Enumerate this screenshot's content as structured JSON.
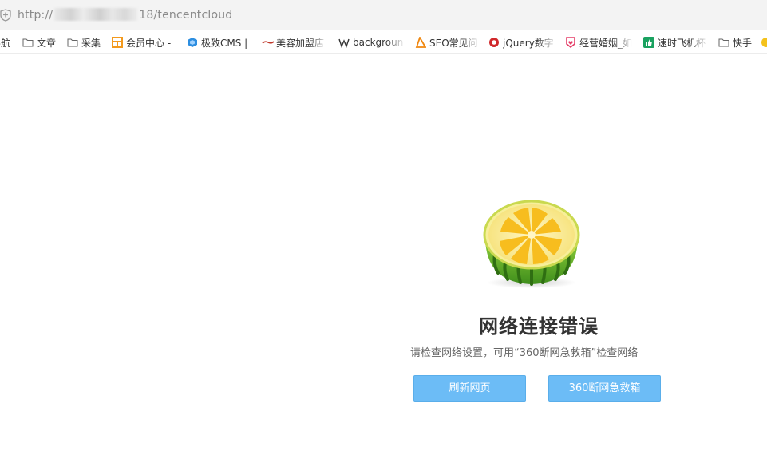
{
  "address_bar": {
    "url_prefix": "http://",
    "url_suffix": "18/tencentcloud",
    "icon": "shield-icon"
  },
  "bookmarks": [
    {
      "label": "导航",
      "icon": "partial-icon"
    },
    {
      "label": "文章",
      "icon": "folder-icon"
    },
    {
      "label": "采集",
      "icon": "folder-icon"
    },
    {
      "label": "会员中心 -",
      "icon": "orange-grid-icon"
    },
    {
      "label": "极致CMS |",
      "icon": "blue-cube-icon"
    },
    {
      "label": "美容加盟店",
      "icon": "red-logo-icon"
    },
    {
      "label": "backgroun",
      "icon": "w3-icon"
    },
    {
      "label": "SEO常见问",
      "icon": "orange-triangle-icon"
    },
    {
      "label": "jQuery数字",
      "icon": "red-circle-icon"
    },
    {
      "label": "经营婚姻_如",
      "icon": "pink-heart-icon"
    },
    {
      "label": "速时飞机杯",
      "icon": "green-thumb-icon"
    },
    {
      "label": "快手",
      "icon": "folder-icon"
    }
  ],
  "error": {
    "title": "网络连接错误",
    "description": "请检查网络设置，可用“360断网急救箱”检查网络",
    "illustration": "watermelon-lemon-icon"
  },
  "buttons": {
    "refresh": "刷新网页",
    "rescue": "360断网急救箱"
  },
  "colors": {
    "button_bg": "#6cbcf6",
    "title": "#333333",
    "subtitle": "#666666"
  }
}
